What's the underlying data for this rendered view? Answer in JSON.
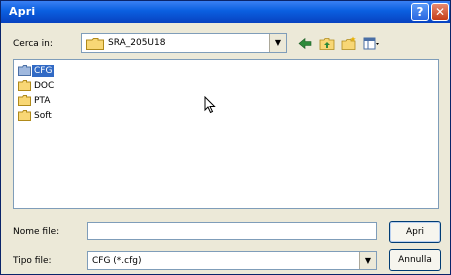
{
  "window": {
    "title": "Apri",
    "help_glyph": "?",
    "close_glyph": "✕",
    "title_color": "#0a5fe0"
  },
  "toolbar": {
    "look_in_label": "Cerca in:",
    "look_in_value": "SRA_205U18",
    "icons": [
      "back-arrow-icon",
      "up-folder-icon",
      "new-folder-icon",
      "views-menu-icon"
    ]
  },
  "file_list": {
    "items": [
      {
        "label": "CFG",
        "icon": "folder-icon",
        "selected": true
      },
      {
        "label": "DOC",
        "icon": "folder-icon",
        "selected": false
      },
      {
        "label": "PTA",
        "icon": "folder-icon",
        "selected": false
      },
      {
        "label": "Soft",
        "icon": "folder-icon",
        "selected": false
      }
    ],
    "selection_color": "#316ac5"
  },
  "file_name": {
    "label": "Nome file:",
    "value": ""
  },
  "file_type": {
    "label": "Tipo file:",
    "value": "CFG (*.cfg)"
  },
  "buttons": {
    "open": "Apri",
    "cancel": "Annulla"
  }
}
